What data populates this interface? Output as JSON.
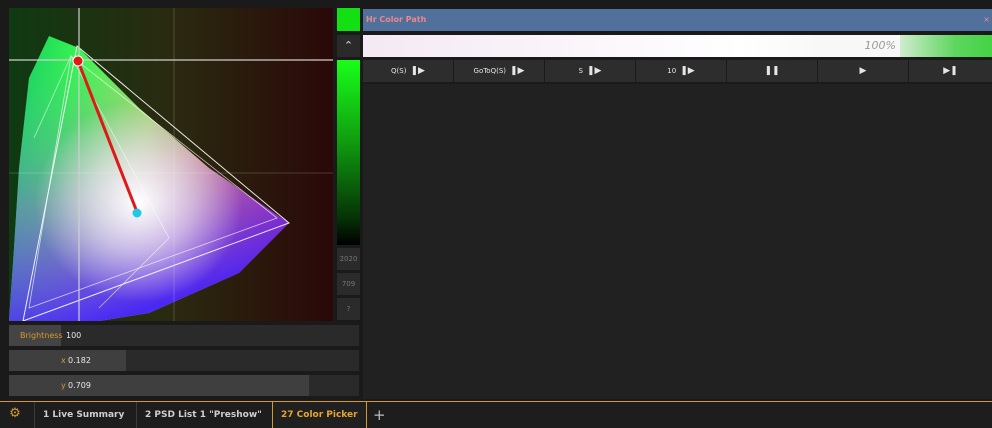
{
  "picker": {
    "brightness_label": "Brightness",
    "brightness_value": "100",
    "x_label": "x",
    "x_value": "0.182",
    "y_label": "y",
    "y_value": "0.709",
    "side_options": [
      "2020",
      "709",
      "?"
    ]
  },
  "color_path": {
    "title": "Hr Color Path",
    "progress_text": "100%",
    "buttons": [
      {
        "label": "Q(S)",
        "icon": "play-step-icon"
      },
      {
        "label": "GoToQ(S)",
        "icon": "play-step-icon"
      },
      {
        "label": "S",
        "icon": "play-step-icon"
      },
      {
        "label": "10",
        "icon": "play-step-icon"
      },
      {
        "label": "",
        "icon": "pause-icon"
      },
      {
        "label": "",
        "icon": "play-icon"
      },
      {
        "label": "",
        "icon": "skip-icon"
      }
    ]
  },
  "tabs": [
    {
      "label": "1 Live Summary"
    },
    {
      "label": "2 PSD List 1 \"Preshow\""
    },
    {
      "label": "27 Color Picker"
    }
  ],
  "colors": {
    "accent": "#d69a2a",
    "title_bar": "#51709b",
    "selected_green": "#13e013"
  }
}
